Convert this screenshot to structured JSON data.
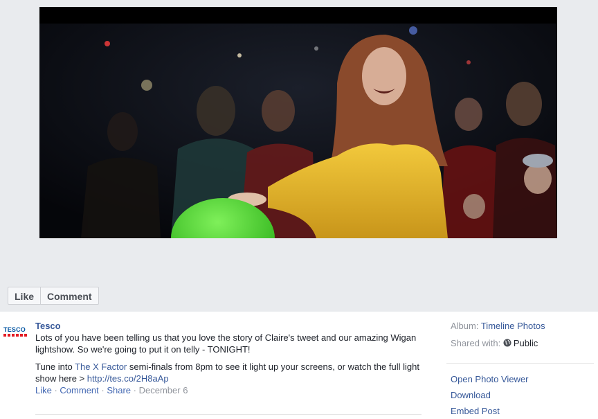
{
  "actions": {
    "like_label": "Like",
    "comment_label": "Comment"
  },
  "post": {
    "page_name": "Tesco",
    "logo_text": "TESCO",
    "paragraph1": "Lots of you have been telling us that you love the story of Claire's tweet and our amazing Wigan lightshow. So we're going to put it on telly - TONIGHT!",
    "p2_before": "Tune into ",
    "p2_link": "The X Factor",
    "p2_after": " semi-finals from 8pm to see it light up your screens, or watch the full light show here > ",
    "p2_url": "http://tes.co/2H8aAp",
    "meta_like": "Like",
    "meta_comment": "Comment",
    "meta_share": "Share",
    "meta_date": "December 6",
    "meta_sep": " · "
  },
  "sidebar": {
    "album_label": "Album: ",
    "album_name": "Timeline Photos",
    "shared_label": "Shared with: ",
    "shared_icon": "globe-icon",
    "shared_value": "Public",
    "links": [
      "Open Photo Viewer",
      "Download",
      "Embed Post"
    ]
  },
  "colors": {
    "link": "#365899",
    "muted": "#90949c",
    "stage": "#e9ebee",
    "coat": "#e0b52a",
    "ball": "#49d62c"
  }
}
